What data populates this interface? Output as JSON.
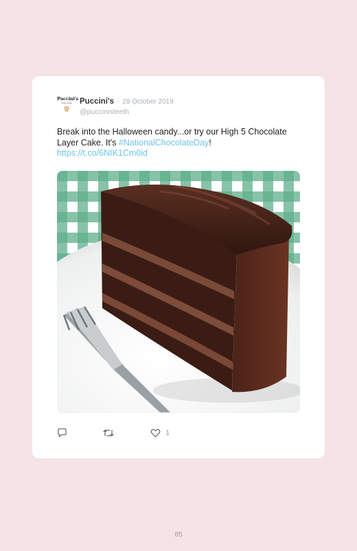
{
  "tweet": {
    "avatar_brand": "Puccini's",
    "avatar_tagline": "smile studio",
    "author_name": "Puccini's",
    "separator": "·",
    "date": "28 October 2019",
    "handle": "@puccinisteeth",
    "text_part1": "Break into the Halloween candy...or try our High 5 Chocolate Layer Cake. It's ",
    "hashtag": "#NationalChocolateDay",
    "text_part2": "!",
    "url": "https://t.co/6NIK1Cm0id",
    "image_subject": "chocolate layer cake slice with fork on white plate, green gingham tablecloth",
    "reply_icon": "reply-icon",
    "retweet_icon": "retweet-icon",
    "like_icon": "heart-icon",
    "like_count": "1"
  },
  "page": {
    "number": "85"
  },
  "colors": {
    "background": "#f6e3e5",
    "card": "#ffffff",
    "link": "#6fc3e8",
    "muted": "#a8b0b8"
  }
}
